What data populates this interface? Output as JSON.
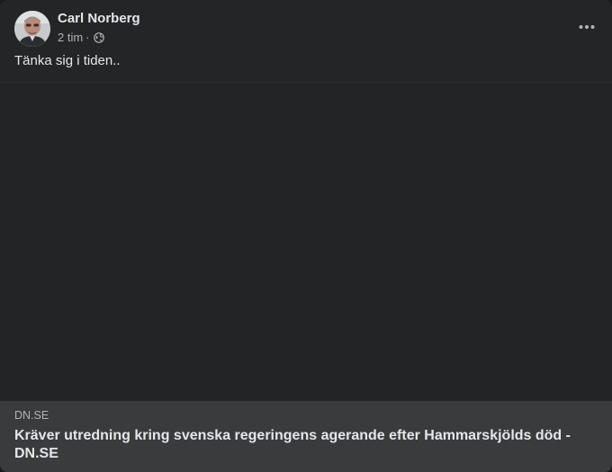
{
  "post": {
    "author": "Carl Norberg",
    "time": "2 tim",
    "separator": "·",
    "privacy_icon": "globe-icon",
    "text": "Tänka sig i tiden..",
    "more_icon": "more-options-icon"
  },
  "link_preview": {
    "domain": "DN.SE",
    "title": "Kräver utredning kring svenska regeringens agerande efter Hammarskjölds död - DN.SE"
  },
  "colors": {
    "card_background": "#242526",
    "link_preview_background": "#3a3b3c",
    "primary_text": "#e4e6eb",
    "secondary_text": "#b0b3b8"
  }
}
